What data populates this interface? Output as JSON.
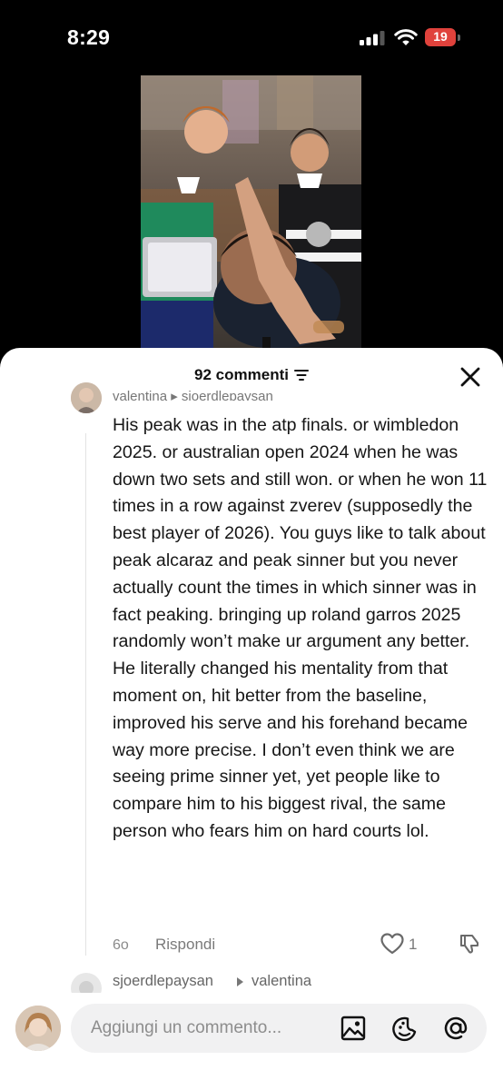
{
  "status_bar": {
    "time": "8:29",
    "battery": "19"
  },
  "video": {
    "icon": "video-thumbnail"
  },
  "comments_sheet": {
    "title": "92 commenti",
    "previous_comment": {
      "names": "valentina ▸ sjoerdlepaysan"
    },
    "comment": {
      "text": "His peak was in the atp finals. or wimbledon 2025. or australian open 2024 when he was down two sets and still won. or when he won 11 times in a row against zverev (supposedly the best player of 2026). You guys like to talk about peak alcaraz and peak sinner but you never actually count the times in which sinner was in fact peaking. bringing up roland garros 2025 randomly won’t make ur argument any better. He literally changed his mentality from that moment on, hit better from the baseline, improved his serve and his forehand became way more precise. I don’t even think we are seeing prime sinner yet, yet people like to compare him to his biggest rival, the same person who fears him on hard courts lol.",
      "time": "6o",
      "reply_label": "Rispondi",
      "like_count": "1"
    },
    "next_comment": {
      "user": "sjoerdlepaysan",
      "reply_to": "valentina"
    }
  },
  "composer": {
    "placeholder": "Aggiungi un commento..."
  }
}
